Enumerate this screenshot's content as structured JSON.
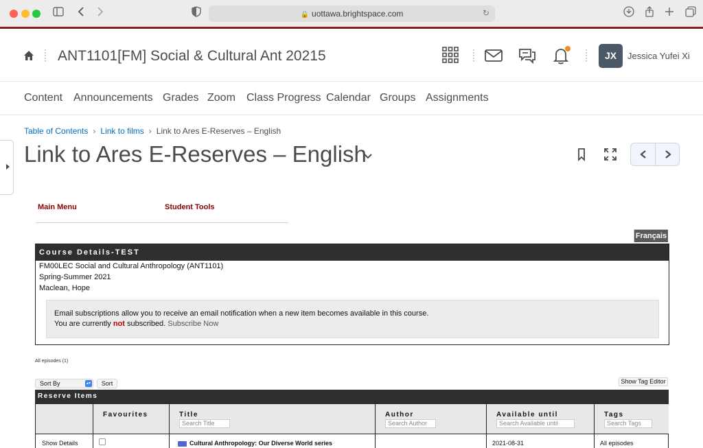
{
  "browser": {
    "url": "uottawa.brightspace.com"
  },
  "header": {
    "course_title": "ANT1101[FM] Social & Cultural Ant 20215",
    "avatar_initials": "JX",
    "user_name": "Jessica Yufei Xi"
  },
  "tabs": [
    "Content",
    "Announcements",
    "Grades",
    "Zoom",
    "Class Progress",
    "Calendar",
    "Groups",
    "Assignments"
  ],
  "breadcrumb": {
    "items": [
      "Table of Contents",
      "Link to films"
    ],
    "current": "Link to Ares E-Reserves – English"
  },
  "page": {
    "title": "Link to Ares E-Reserves – English"
  },
  "ares": {
    "main_menu": "Main Menu",
    "student_tools": "Student Tools",
    "language_button": "Français",
    "course_details": {
      "heading": "Course Details-TEST",
      "course": "FM00LEC Social and Cultural Anthropology (ANT1101)",
      "term": "Spring-Summer 2021",
      "instructor": "Maclean, Hope"
    },
    "email": {
      "line1": "Email subscriptions allow you to receive an email notification when a new item becomes available in this course.",
      "line2_pre": "You are currently ",
      "line2_not": "not",
      "line2_post": " subscribed. ",
      "subscribe_link": "Subscribe Now"
    },
    "all_episodes": "All episodes",
    "all_episodes_count": "(1)",
    "sort_by": "Sort By",
    "sort_button": "Sort",
    "tag_editor_button": "Show Tag Editor",
    "reserve_heading": "Reserve Items",
    "columns": {
      "favourites": "Favourites",
      "title": "Title",
      "title_placeholder": "Search Title",
      "author": "Author",
      "author_placeholder": "Search Author",
      "available": "Available until",
      "available_placeholder": "Search Available until",
      "tags": "Tags",
      "tags_placeholder": "Search Tags"
    },
    "row": {
      "show_details": "Show Details",
      "title": "Cultural Anthropology: Our Diverse World series",
      "available": "2021-08-31",
      "tags": "All episodes"
    }
  },
  "colors": {
    "accent_line": "#8a1c1c",
    "link": "#006fbf",
    "ares_red": "#8c0000",
    "notification_dot": "#f18a26"
  }
}
